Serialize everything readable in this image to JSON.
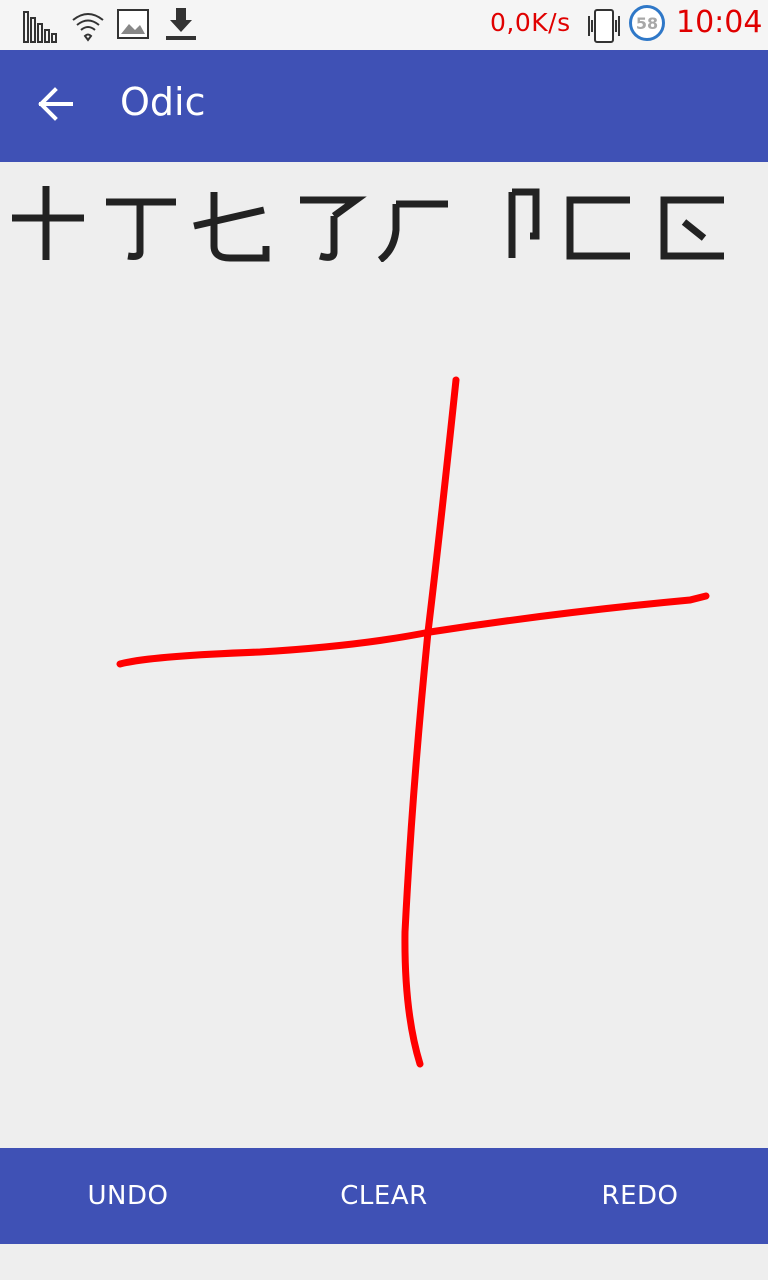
{
  "status_bar": {
    "net_speed": "0,0K/s",
    "battery_level": "58",
    "time": "10:04",
    "icons": [
      "signal-bars-icon",
      "wifi-icon",
      "image-icon",
      "download-icon",
      "vibrate-icon",
      "battery-circle-icon"
    ]
  },
  "app_bar": {
    "title": "Odic",
    "back_icon": "arrow-back-icon"
  },
  "candidates": [
    "十",
    "丁",
    "七",
    "了",
    "厂",
    "卩",
    "匚",
    "匸"
  ],
  "drawing": {
    "stroke_color": "#ff0000",
    "strokes": 2
  },
  "bottom_bar": {
    "undo_label": "UNDO",
    "clear_label": "CLEAR",
    "redo_label": "REDO"
  },
  "colors": {
    "primary": "#3f51b5",
    "background": "#eeeeee",
    "status_accent": "#e00000"
  }
}
